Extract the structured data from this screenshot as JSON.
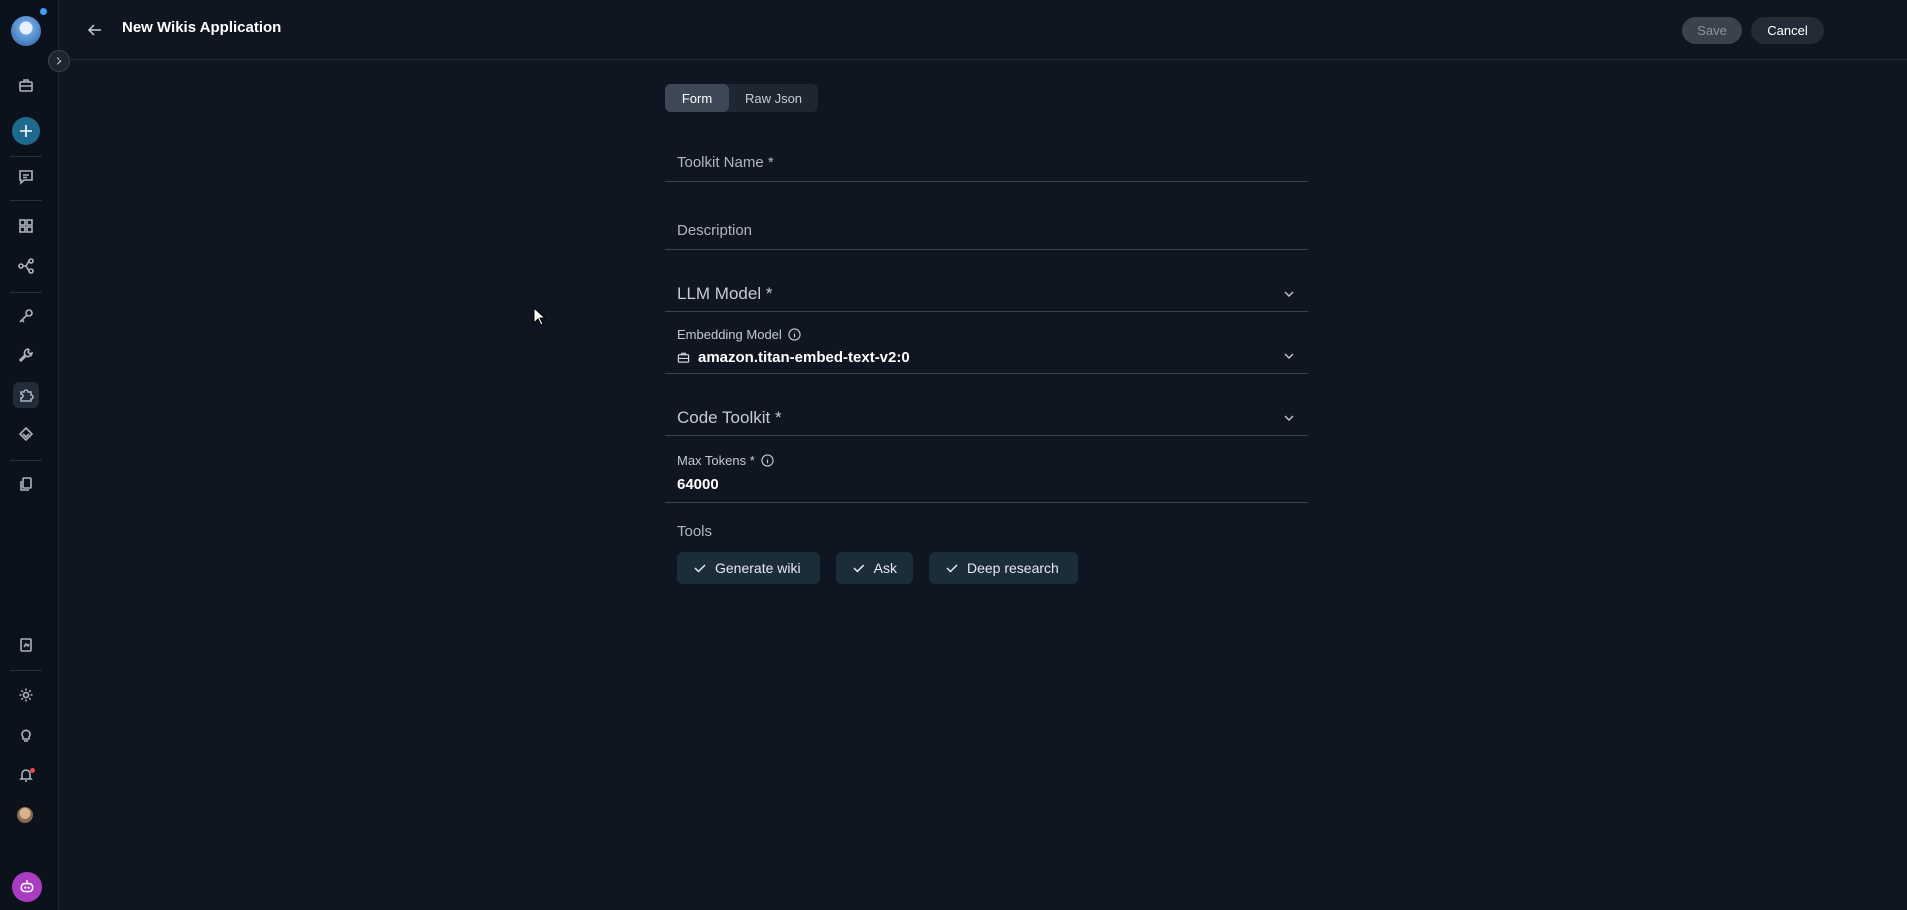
{
  "header": {
    "title": "New Wikis Application",
    "save_label": "Save",
    "cancel_label": "Cancel"
  },
  "tabs": [
    {
      "label": "Form",
      "active": true
    },
    {
      "label": "Raw Json",
      "active": false
    }
  ],
  "form": {
    "toolkit_name": {
      "label": "Toolkit Name *",
      "value": ""
    },
    "description": {
      "label": "Description",
      "value": ""
    },
    "llm_model": {
      "label": "LLM Model *",
      "value": ""
    },
    "embedding_model": {
      "label": "Embedding Model",
      "value": "amazon.titan-embed-text-v2:0"
    },
    "code_toolkit": {
      "label": "Code Toolkit *",
      "value": ""
    },
    "max_tokens": {
      "label": "Max Tokens *",
      "value": "64000"
    },
    "tools": {
      "label": "Tools",
      "items": [
        {
          "label": "Generate wiki",
          "checked": true
        },
        {
          "label": "Ask",
          "checked": true
        },
        {
          "label": "Deep research",
          "checked": true
        }
      ]
    }
  },
  "sidebar": {
    "icons": [
      "briefcase-icon",
      "plus-icon",
      "chat-icon",
      "grid-icon",
      "flow-icon",
      "key-icon",
      "wrench-icon",
      "puzzle-icon",
      "layers-icon",
      "documents-icon",
      "report-icon",
      "gear-icon",
      "bulb-icon",
      "bell-icon",
      "avatar",
      "bot-icon"
    ],
    "active": "puzzle-icon"
  },
  "colors": {
    "background": "#0f1621",
    "sidebar": "#0c121b",
    "accent": "#1e6a8e",
    "chip": "#1c2d3a",
    "bot": "#a93cc0"
  }
}
